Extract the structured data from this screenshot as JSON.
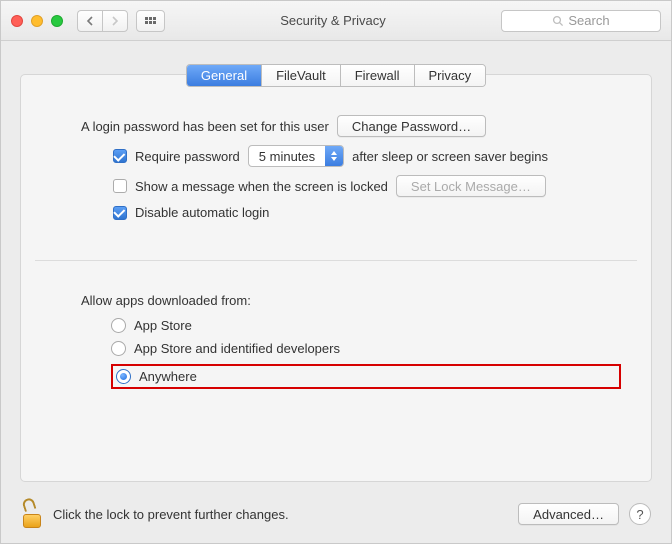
{
  "window": {
    "title": "Security & Privacy",
    "search_placeholder": "Search"
  },
  "tabs": {
    "general": "General",
    "filevault": "FileVault",
    "firewall": "Firewall",
    "privacy": "Privacy"
  },
  "login": {
    "password_set_text": "A login password has been set for this user",
    "change_password_btn": "Change Password…",
    "require_password_label": "Require password",
    "require_password_value": "5 minutes",
    "require_password_suffix": "after sleep or screen saver begins",
    "show_message_label": "Show a message when the screen is locked",
    "set_lock_message_btn": "Set Lock Message…",
    "disable_auto_login_label": "Disable automatic login"
  },
  "gatekeeper": {
    "heading": "Allow apps downloaded from:",
    "options": {
      "appstore": "App Store",
      "identified": "App Store and identified developers",
      "anywhere": "Anywhere"
    }
  },
  "footer": {
    "lock_text": "Click the lock to prevent further changes.",
    "advanced_btn": "Advanced…",
    "help": "?"
  }
}
